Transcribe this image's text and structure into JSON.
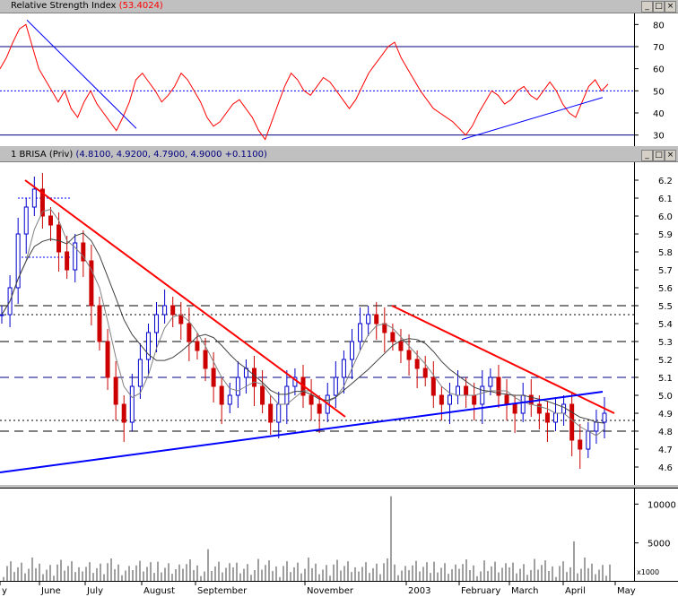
{
  "rsi_pane": {
    "title": "Relative Strength Index",
    "value": "(53.4024)",
    "y_ticks": [
      "80",
      "70",
      "60",
      "50",
      "40",
      "30"
    ]
  },
  "price_pane": {
    "title": "1 BRISA (Priv)",
    "values": "(4.8100, 4.9200, 4.7900, 4.9000 +0.1100)",
    "y_ticks": [
      "6.2",
      "6.1",
      "6.0",
      "5.9",
      "5.8",
      "5.7",
      "5.6",
      "5.5",
      "5.4",
      "5.3",
      "5.2",
      "5.1",
      "5.0",
      "4.9",
      "4.8",
      "4.7",
      "4.6"
    ]
  },
  "volume_pane": {
    "y_ticks": [
      "10000",
      "5000"
    ],
    "unit_label": "x1000"
  },
  "x_axis": {
    "labels": [
      "y",
      "June",
      "July",
      "August",
      "September",
      "November",
      "2003",
      "February",
      "March",
      "April",
      "May"
    ]
  },
  "colors": {
    "rsi_line": "#ff0000",
    "trend_red": "#ff0000",
    "trend_blue": "#0000ff",
    "candle_up": "#0000cc",
    "candle_down": "#cc0000",
    "hline": "#000080"
  },
  "chart_data": [
    {
      "type": "line",
      "title": "Relative Strength Index (53.4024)",
      "ylim": [
        25,
        85
      ],
      "series": [
        {
          "name": "Relative Strength Index",
          "values": [
            60,
            65,
            72,
            78,
            80,
            70,
            60,
            55,
            50,
            45,
            50,
            42,
            38,
            45,
            50,
            44,
            40,
            36,
            32,
            38,
            45,
            55,
            58,
            54,
            50,
            45,
            48,
            52,
            58,
            55,
            50,
            45,
            38,
            34,
            36,
            40,
            44,
            46,
            42,
            38,
            32,
            28,
            36,
            44,
            52,
            58,
            55,
            50,
            48,
            52,
            56,
            54,
            50,
            46,
            42,
            46,
            52,
            58,
            62,
            66,
            70,
            72,
            65,
            60,
            55,
            50,
            46,
            42,
            40,
            38,
            36,
            33,
            30,
            34,
            40,
            45,
            50,
            48,
            44,
            46,
            50,
            52,
            48,
            46,
            50,
            54,
            50,
            44,
            40,
            38,
            45,
            52,
            55,
            50,
            53
          ]
        }
      ]
    },
    {
      "type": "line",
      "title": "1 BRISA (Priv)",
      "ylim": [
        4.5,
        6.3
      ],
      "series": [
        {
          "name": "1 BRISA (Priv)",
          "values": [
            5.45,
            5.6,
            5.9,
            6.05,
            6.15,
            6.0,
            5.95,
            5.8,
            5.7,
            5.85,
            5.75,
            5.5,
            5.3,
            5.1,
            4.95,
            4.85,
            5.05,
            5.2,
            5.35,
            5.45,
            5.5,
            5.45,
            5.4,
            5.3,
            5.25,
            5.15,
            5.05,
            4.95,
            5.0,
            5.1,
            5.15,
            5.05,
            4.95,
            4.85,
            4.95,
            5.05,
            5.1,
            5.0,
            4.95,
            4.9,
            5.0,
            5.1,
            5.2,
            5.3,
            5.4,
            5.45,
            5.4,
            5.35,
            5.3,
            5.25,
            5.2,
            5.15,
            5.1,
            5.0,
            4.95,
            5.0,
            5.05,
            5.0,
            4.95,
            5.05,
            5.1,
            5.0,
            4.95,
            4.9,
            5.0,
            4.95,
            4.9,
            4.85,
            4.9,
            4.95,
            4.75,
            4.7,
            4.8,
            4.85,
            4.9
          ]
        }
      ]
    }
  ]
}
